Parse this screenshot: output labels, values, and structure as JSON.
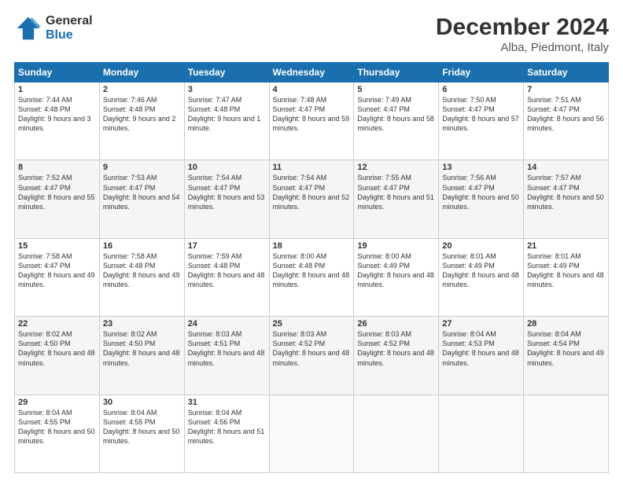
{
  "logo": {
    "line1": "General",
    "line2": "Blue"
  },
  "title": "December 2024",
  "subtitle": "Alba, Piedmont, Italy",
  "days_header": [
    "Sunday",
    "Monday",
    "Tuesday",
    "Wednesday",
    "Thursday",
    "Friday",
    "Saturday"
  ],
  "weeks": [
    [
      {
        "day": "1",
        "sunrise": "7:44 AM",
        "sunset": "4:48 PM",
        "daylight": "9 hours and 3 minutes."
      },
      {
        "day": "2",
        "sunrise": "7:46 AM",
        "sunset": "4:48 PM",
        "daylight": "9 hours and 2 minutes."
      },
      {
        "day": "3",
        "sunrise": "7:47 AM",
        "sunset": "4:48 PM",
        "daylight": "9 hours and 1 minute."
      },
      {
        "day": "4",
        "sunrise": "7:48 AM",
        "sunset": "4:47 PM",
        "daylight": "8 hours and 59 minutes."
      },
      {
        "day": "5",
        "sunrise": "7:49 AM",
        "sunset": "4:47 PM",
        "daylight": "8 hours and 58 minutes."
      },
      {
        "day": "6",
        "sunrise": "7:50 AM",
        "sunset": "4:47 PM",
        "daylight": "8 hours and 57 minutes."
      },
      {
        "day": "7",
        "sunrise": "7:51 AM",
        "sunset": "4:47 PM",
        "daylight": "8 hours and 56 minutes."
      }
    ],
    [
      {
        "day": "8",
        "sunrise": "7:52 AM",
        "sunset": "4:47 PM",
        "daylight": "8 hours and 55 minutes."
      },
      {
        "day": "9",
        "sunrise": "7:53 AM",
        "sunset": "4:47 PM",
        "daylight": "8 hours and 54 minutes."
      },
      {
        "day": "10",
        "sunrise": "7:54 AM",
        "sunset": "4:47 PM",
        "daylight": "8 hours and 53 minutes."
      },
      {
        "day": "11",
        "sunrise": "7:54 AM",
        "sunset": "4:47 PM",
        "daylight": "8 hours and 52 minutes."
      },
      {
        "day": "12",
        "sunrise": "7:55 AM",
        "sunset": "4:47 PM",
        "daylight": "8 hours and 51 minutes."
      },
      {
        "day": "13",
        "sunrise": "7:56 AM",
        "sunset": "4:47 PM",
        "daylight": "8 hours and 50 minutes."
      },
      {
        "day": "14",
        "sunrise": "7:57 AM",
        "sunset": "4:47 PM",
        "daylight": "8 hours and 50 minutes."
      }
    ],
    [
      {
        "day": "15",
        "sunrise": "7:58 AM",
        "sunset": "4:47 PM",
        "daylight": "8 hours and 49 minutes."
      },
      {
        "day": "16",
        "sunrise": "7:58 AM",
        "sunset": "4:48 PM",
        "daylight": "8 hours and 49 minutes."
      },
      {
        "day": "17",
        "sunrise": "7:59 AM",
        "sunset": "4:48 PM",
        "daylight": "8 hours and 48 minutes."
      },
      {
        "day": "18",
        "sunrise": "8:00 AM",
        "sunset": "4:48 PM",
        "daylight": "8 hours and 48 minutes."
      },
      {
        "day": "19",
        "sunrise": "8:00 AM",
        "sunset": "4:49 PM",
        "daylight": "8 hours and 48 minutes."
      },
      {
        "day": "20",
        "sunrise": "8:01 AM",
        "sunset": "4:49 PM",
        "daylight": "8 hours and 48 minutes."
      },
      {
        "day": "21",
        "sunrise": "8:01 AM",
        "sunset": "4:49 PM",
        "daylight": "8 hours and 48 minutes."
      }
    ],
    [
      {
        "day": "22",
        "sunrise": "8:02 AM",
        "sunset": "4:50 PM",
        "daylight": "8 hours and 48 minutes."
      },
      {
        "day": "23",
        "sunrise": "8:02 AM",
        "sunset": "4:50 PM",
        "daylight": "8 hours and 48 minutes."
      },
      {
        "day": "24",
        "sunrise": "8:03 AM",
        "sunset": "4:51 PM",
        "daylight": "8 hours and 48 minutes."
      },
      {
        "day": "25",
        "sunrise": "8:03 AM",
        "sunset": "4:52 PM",
        "daylight": "8 hours and 48 minutes."
      },
      {
        "day": "26",
        "sunrise": "8:03 AM",
        "sunset": "4:52 PM",
        "daylight": "8 hours and 48 minutes."
      },
      {
        "day": "27",
        "sunrise": "8:04 AM",
        "sunset": "4:53 PM",
        "daylight": "8 hours and 48 minutes."
      },
      {
        "day": "28",
        "sunrise": "8:04 AM",
        "sunset": "4:54 PM",
        "daylight": "8 hours and 49 minutes."
      }
    ],
    [
      {
        "day": "29",
        "sunrise": "8:04 AM",
        "sunset": "4:55 PM",
        "daylight": "8 hours and 50 minutes."
      },
      {
        "day": "30",
        "sunrise": "8:04 AM",
        "sunset": "4:55 PM",
        "daylight": "8 hours and 50 minutes."
      },
      {
        "day": "31",
        "sunrise": "8:04 AM",
        "sunset": "4:56 PM",
        "daylight": "8 hours and 51 minutes."
      },
      null,
      null,
      null,
      null
    ]
  ]
}
